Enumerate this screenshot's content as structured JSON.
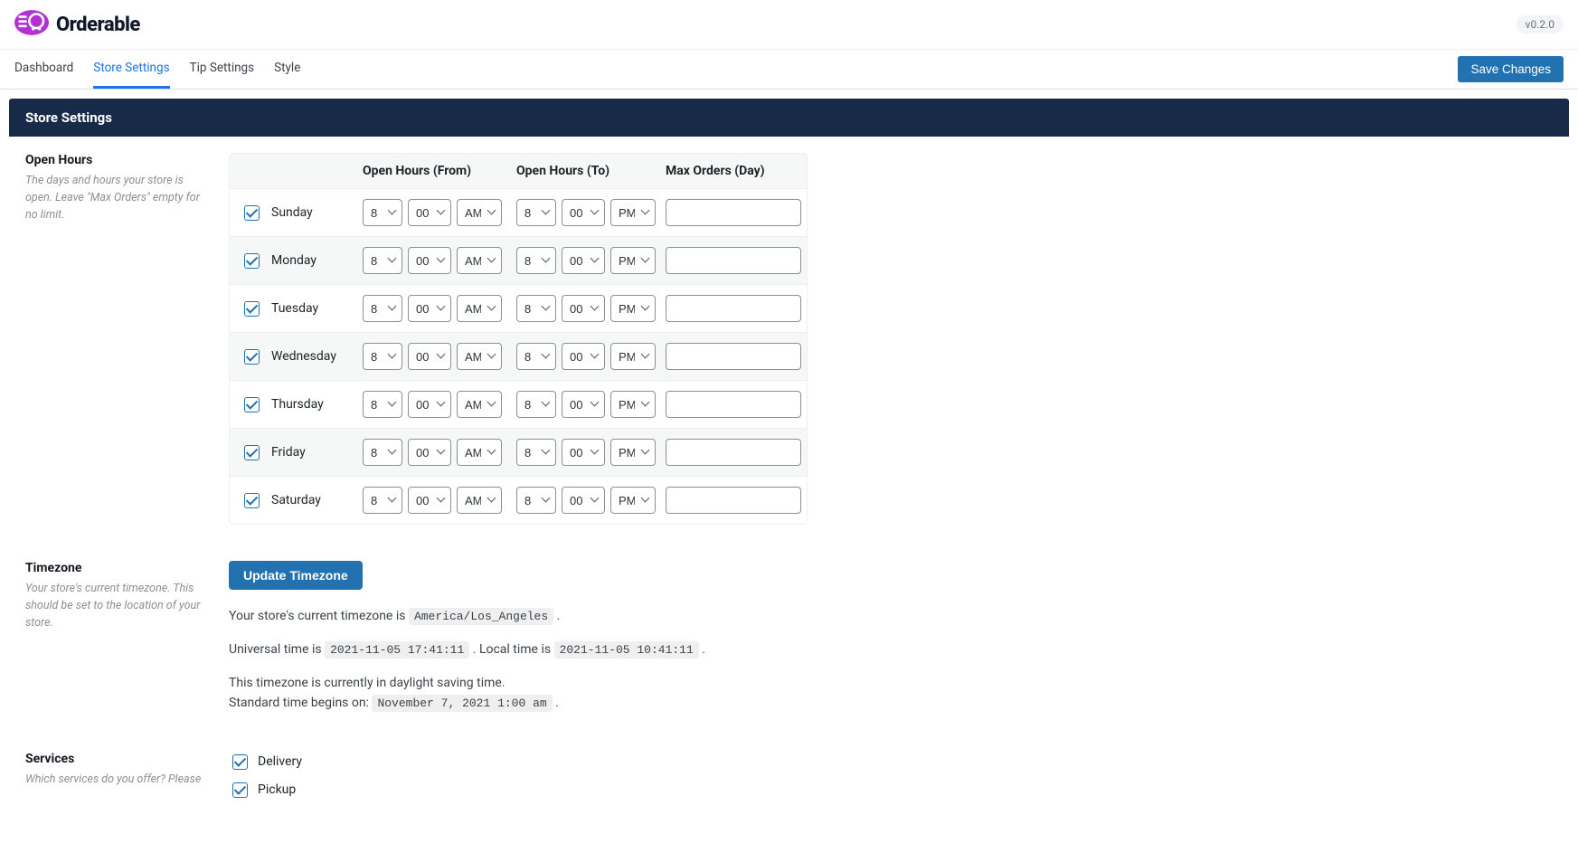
{
  "app": {
    "name": "Orderable",
    "version": "v0.2.0"
  },
  "tabs": [
    "Dashboard",
    "Store Settings",
    "Tip Settings",
    "Style"
  ],
  "active_tab": 1,
  "save_label": "Save Changes",
  "section_title": "Store Settings",
  "open_hours": {
    "title": "Open Hours",
    "desc": "The days and hours your store is open. Leave \"Max Orders\" empty for no limit.",
    "cols": [
      "Open Hours (From)",
      "Open Hours (To)",
      "Max Orders (Day)"
    ],
    "rows": [
      {
        "day": "Sunday",
        "checked": true,
        "fh": "8",
        "fm": "00",
        "fap": "AM",
        "th": "8",
        "tm": "00",
        "tap": "PM",
        "max": ""
      },
      {
        "day": "Monday",
        "checked": true,
        "fh": "8",
        "fm": "00",
        "fap": "AM",
        "th": "8",
        "tm": "00",
        "tap": "PM",
        "max": ""
      },
      {
        "day": "Tuesday",
        "checked": true,
        "fh": "8",
        "fm": "00",
        "fap": "AM",
        "th": "8",
        "tm": "00",
        "tap": "PM",
        "max": ""
      },
      {
        "day": "Wednesday",
        "checked": true,
        "fh": "8",
        "fm": "00",
        "fap": "AM",
        "th": "8",
        "tm": "00",
        "tap": "PM",
        "max": ""
      },
      {
        "day": "Thursday",
        "checked": true,
        "fh": "8",
        "fm": "00",
        "fap": "AM",
        "th": "8",
        "tm": "00",
        "tap": "PM",
        "max": ""
      },
      {
        "day": "Friday",
        "checked": true,
        "fh": "8",
        "fm": "00",
        "fap": "AM",
        "th": "8",
        "tm": "00",
        "tap": "PM",
        "max": ""
      },
      {
        "day": "Saturday",
        "checked": true,
        "fh": "8",
        "fm": "00",
        "fap": "AM",
        "th": "8",
        "tm": "00",
        "tap": "PM",
        "max": ""
      }
    ]
  },
  "timezone": {
    "title": "Timezone",
    "desc": "Your store's current timezone. This should be set to the location of your store.",
    "button": "Update Timezone",
    "line1_pre": "Your store's current timezone is ",
    "tz_value": "America/Los_Angeles",
    "line2_pre": "Universal time is ",
    "utc": "2021-11-05 17:41:11",
    "line2_mid": ". Local time is ",
    "local": "2021-11-05 10:41:11",
    "line3": "This timezone is currently in daylight saving time.",
    "line4_pre": "Standard time begins on: ",
    "std_begin": "November 7, 2021 1:00 am"
  },
  "services": {
    "title": "Services",
    "desc": "Which services do you offer? Please",
    "options": [
      {
        "label": "Delivery",
        "checked": true
      },
      {
        "label": "Pickup",
        "checked": true
      }
    ]
  }
}
